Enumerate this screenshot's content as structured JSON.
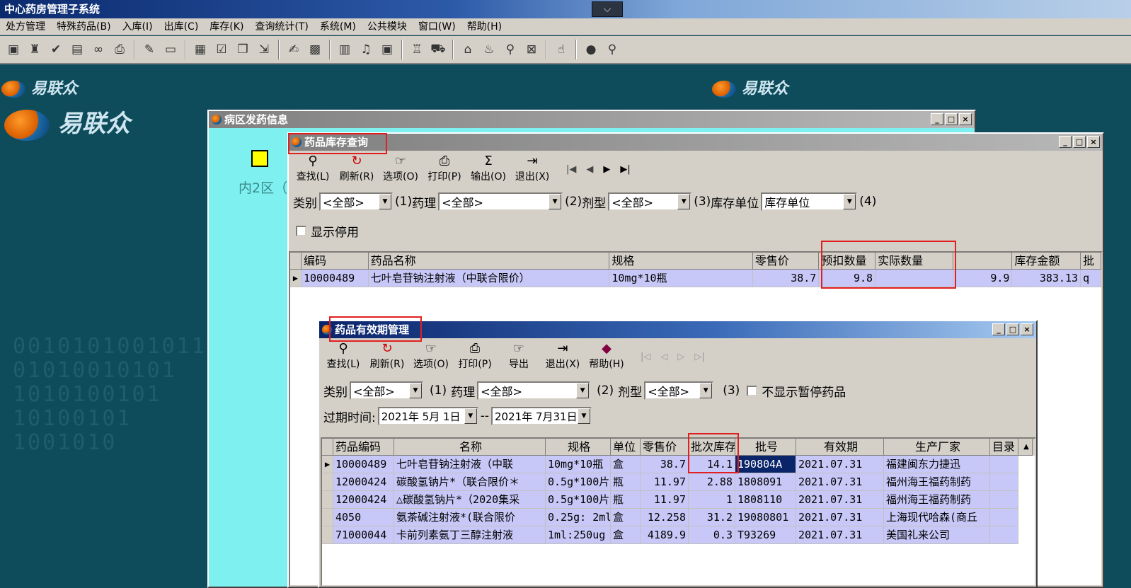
{
  "app": {
    "title": "中心药房管理子系统"
  },
  "menu": [
    "处方管理",
    "特殊药品(B)",
    "入库(I)",
    "出库(C)",
    "库存(K)",
    "查询统计(T)",
    "系统(M)",
    "公共模块",
    "窗口(W)",
    "帮助(H)"
  ],
  "brand": {
    "logo_text": "易联众"
  },
  "ward_window": {
    "title": "病区发药信息",
    "area_label": "内2区（"
  },
  "stock_window": {
    "title": "药品库存查询",
    "buttons": [
      "查找(L)",
      "刷新(R)",
      "选项(O)",
      "打印(P)",
      "输出(O)",
      "退出(X)"
    ],
    "filters": {
      "cat_label": "类别",
      "cat_value": "<全部>",
      "n1": "(1)",
      "pharm_label": "药理",
      "pharm_value": "<全部>",
      "n2": "(2)",
      "form_label": "剂型",
      "form_value": "<全部>",
      "n3": "(3)",
      "unit_label": "库存单位",
      "unit_value": "库存单位",
      "n4": "(4)"
    },
    "show_disabled": "显示停用",
    "columns": [
      "编码",
      "药品名称",
      "规格",
      "零售价",
      "预扣数量",
      "实际数量",
      "",
      "库存金额",
      "批"
    ],
    "rows": [
      [
        "10000489",
        "七叶皂苷钠注射液（中联合限价）",
        "10mg*10瓶",
        "38.7",
        "9.8",
        "",
        "9.9",
        "383.13",
        "q"
      ]
    ]
  },
  "expiry_window": {
    "title": "药品有效期管理",
    "buttons": [
      "查找(L)",
      "刷新(R)",
      "选项(O)",
      "打印(P)",
      "导出",
      "退出(X)",
      "帮助(H)"
    ],
    "filters": {
      "cat_label": "类别",
      "cat_value": "<全部>",
      "n1": "(1)",
      "pharm_label": "药理",
      "pharm_value": "<全部>",
      "n2": "(2)",
      "form_label": "剂型",
      "form_value": "<全部>",
      "n3": "(3)",
      "hide_paused": "不显示暂停药品"
    },
    "date": {
      "label": "过期时间:",
      "from": "2021年 5月 1日",
      "sep": "--",
      "to": "2021年 7月31日"
    },
    "columns": [
      "药品编码",
      "名称",
      "规格",
      "单位",
      "零售价",
      "批次库存",
      "批号",
      "有效期",
      "生产厂家",
      "目录"
    ],
    "rows": [
      [
        "10000489",
        "七叶皂苷钠注射液（中联",
        "10mg*10瓶",
        "盒",
        "38.7",
        "14.1",
        "190804A",
        "2021.07.31",
        "福建闽东力捷迅",
        ""
      ],
      [
        "12000424",
        "碳酸氢钠片*（联合限价＊",
        "0.5g*100片",
        "瓶",
        "11.97",
        "2.88",
        "1808091",
        "2021.07.31",
        "福州海王福药制药",
        ""
      ],
      [
        "12000424",
        "△碳酸氢钠片*（2020集采",
        "0.5g*100片",
        "瓶",
        "11.97",
        "1",
        "1808110",
        "2021.07.31",
        "福州海王福药制药",
        ""
      ],
      [
        "4050",
        "氨茶碱注射液*(联合限价",
        "0.25g: 2ml",
        "盒",
        "12.258",
        "31.2",
        "19080801",
        "2021.07.31",
        "上海现代哈森(商丘",
        ""
      ],
      [
        "71000044",
        "卡前列素氨丁三醇注射液",
        "1ml:250ug",
        "盒",
        "4189.9",
        "0.3",
        "T93269",
        "2021.07.31",
        "美国礼来公司",
        ""
      ]
    ]
  }
}
